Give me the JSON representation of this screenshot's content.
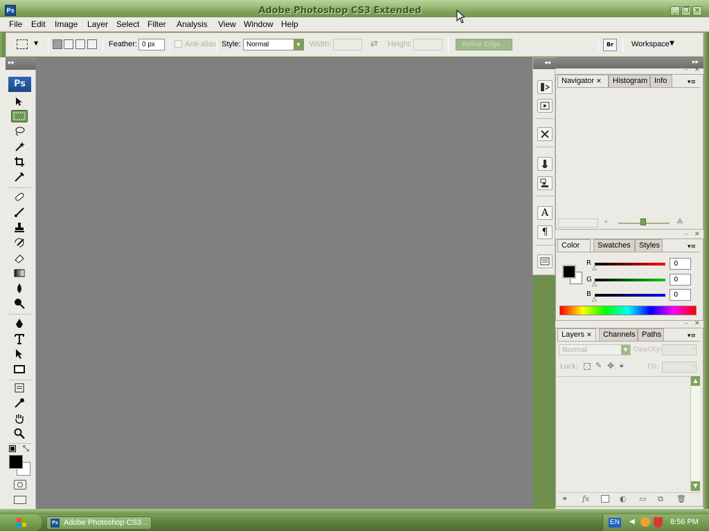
{
  "window": {
    "title": "Adobe Photoshop CS3 Extended",
    "app_icon": "Ps"
  },
  "menubar": {
    "items": [
      "File",
      "Edit",
      "Image",
      "Layer",
      "Select",
      "Filter",
      "Analysis",
      "View",
      "Window",
      "Help"
    ]
  },
  "options": {
    "feather_label": "Feather:",
    "feather_value": "0 px",
    "antialias_label": "Anti-alias",
    "style_label": "Style:",
    "style_value": "Normal",
    "width_label": "Width:",
    "height_label": "Height:",
    "refine_edge_label": "Refine Edge...",
    "workspace_label": "Workspace"
  },
  "toolbox": {
    "logo": "Ps",
    "tools": [
      "move-tool-icon",
      "marquee-tool-icon",
      "lasso-tool-icon",
      "magic-wand-tool-icon",
      "crop-tool-icon",
      "slice-tool-icon",
      "healing-brush-tool-icon",
      "brush-tool-icon",
      "clone-stamp-tool-icon",
      "history-brush-tool-icon",
      "eraser-tool-icon",
      "gradient-tool-icon",
      "blur-tool-icon",
      "dodge-tool-icon",
      "pen-tool-icon",
      "type-tool-icon",
      "path-selection-tool-icon",
      "shape-tool-icon",
      "notes-tool-icon",
      "eyedropper-tool-icon",
      "hand-tool-icon",
      "zoom-tool-icon"
    ]
  },
  "panels": {
    "navigator_group": {
      "tabs": [
        "Navigator",
        "Histogram",
        "Info"
      ]
    },
    "color_group": {
      "tabs": [
        "Color",
        "Swatches",
        "Styles"
      ],
      "r_label": "R",
      "g_label": "G",
      "b_label": "B",
      "r_value": "0",
      "g_value": "0",
      "b_value": "0"
    },
    "layers_group": {
      "tabs": [
        "Layers",
        "Channels",
        "Paths"
      ],
      "blend_mode": "Normal",
      "opacity_label": "Opacity:",
      "lock_label": "Lock:",
      "fill_label": "Fill:"
    }
  },
  "taskbar": {
    "task_label": "Adobe Photoshop CS3...",
    "language": "EN",
    "time": "8:56 PM"
  },
  "colors": {
    "canvas_bg": "#808080",
    "panel_bg": "#ebeae4",
    "frame_green": "#7ea25a"
  }
}
